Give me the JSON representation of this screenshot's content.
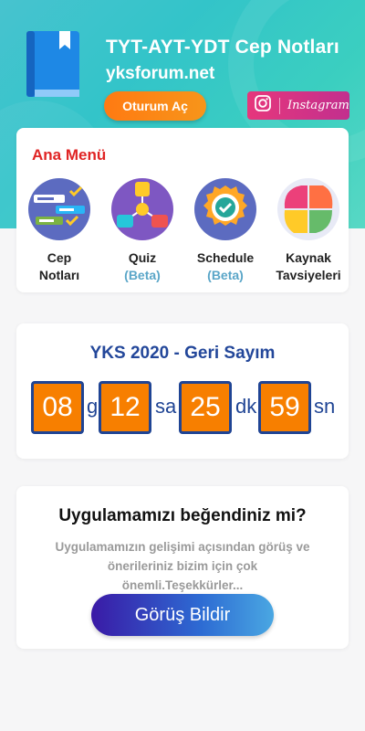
{
  "header": {
    "title": "TYT-AYT-YDT Cep Notları",
    "site": "yksforum.net",
    "login_label": "Oturum Aç",
    "instagram_label": "Instagram"
  },
  "menu": {
    "title": "Ana Menü",
    "items": [
      {
        "line1": "Cep",
        "line2": "Notları",
        "sub": "",
        "icon": "notes-icon"
      },
      {
        "line1": "Quiz",
        "line2": "",
        "sub": "(Beta)",
        "icon": "quiz-icon"
      },
      {
        "line1": "Schedule",
        "line2": "",
        "sub": "(Beta)",
        "icon": "schedule-icon"
      },
      {
        "line1": "Kaynak",
        "line2": "Tavsiyeleri",
        "sub": "",
        "icon": "resources-icon"
      }
    ]
  },
  "countdown": {
    "title": "YKS 2020 - Geri Sayım",
    "days": "08",
    "days_unit": "g",
    "hours": "12",
    "hours_unit": "sa",
    "minutes": "25",
    "minutes_unit": "dk",
    "seconds": "59",
    "seconds_unit": "sn"
  },
  "feedback": {
    "title": "Uygulamamızı beğendiniz mi?",
    "text": "Uygulamamızın gelişimi açısından görüş ve önerileriniz bizim için çok önemli.Teşekkürler...",
    "button_label": "Görüş Bildir"
  },
  "colors": {
    "accent_orange": "#f77f00",
    "countdown_blue": "#1f4494",
    "menu_red": "#e02424",
    "hero_teal": "#33c4c9"
  }
}
